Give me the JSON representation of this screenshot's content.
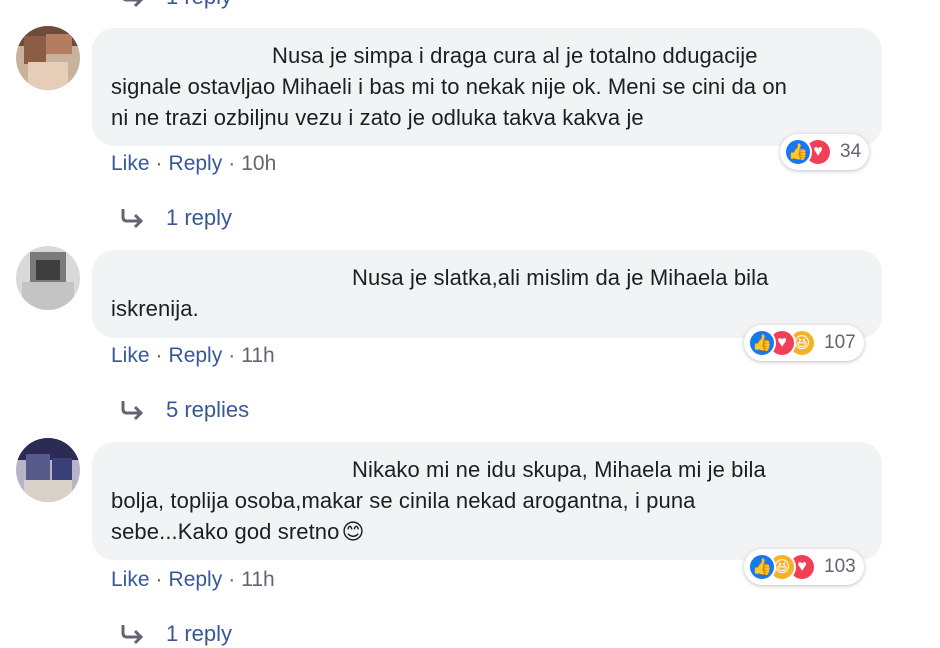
{
  "top_partial": {
    "replies_label": "1 reply"
  },
  "comments": [
    {
      "text_lines": [
        "Nusa je simpa i draga cura al je totalno ddugacije",
        "signale ostavljao Mihaeli i bas mi to nekak nije ok. Meni se cini da on",
        "ni ne trazi ozbiljnu vezu i zato je odluka takva kakva je"
      ],
      "like_label": "Like",
      "reply_label": "Reply",
      "time": "10h",
      "reactions": [
        "like",
        "love"
      ],
      "reaction_count": "34",
      "replies_label": "1 reply"
    },
    {
      "text_lines": [
        "Nusa je slatka,ali mislim da je Mihaela bila",
        "iskrenija."
      ],
      "like_label": "Like",
      "reply_label": "Reply",
      "time": "11h",
      "reactions": [
        "like",
        "love",
        "haha"
      ],
      "reaction_count": "107",
      "replies_label": "5 replies"
    },
    {
      "text_lines": [
        "Nikako mi ne idu skupa, Mihaela mi je bila",
        "bolja, toplija osoba,makar se cinila nekad arogantna, i puna",
        "sebe...Kako god sretno"
      ],
      "emoji": "😊",
      "like_label": "Like",
      "reply_label": "Reply",
      "time": "11h",
      "reactions": [
        "like",
        "haha",
        "love"
      ],
      "reaction_count": "103",
      "replies_label": "1 reply"
    }
  ],
  "colors": {
    "link": "#385898",
    "meta": "#606770",
    "bubble": "#f2f3f5",
    "like": "#1877f2",
    "love": "#f33e58",
    "haha": "#f7b125"
  },
  "icons": [
    "reply-arrow-icon",
    "like-reaction-icon",
    "love-reaction-icon",
    "haha-reaction-icon",
    "smiling-face-emoji"
  ]
}
